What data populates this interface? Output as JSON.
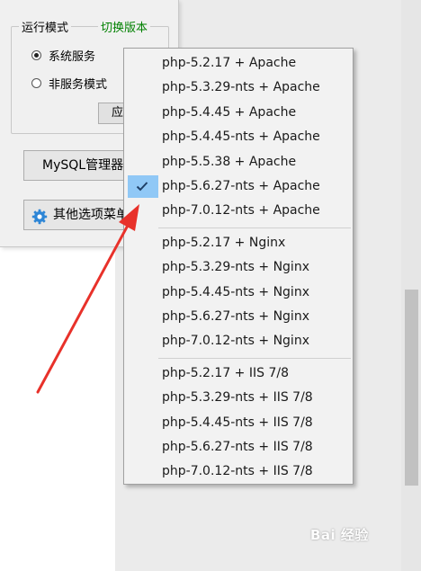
{
  "app": {
    "mode_group": {
      "legend": "运行模式",
      "switch_link": "切换版本",
      "options": [
        {
          "label": "系统服务",
          "checked": true
        },
        {
          "label": "非服务模式",
          "checked": false
        }
      ],
      "apply_label": "应"
    },
    "mysql_button_label": "MySQL管理器",
    "other_button_label": "其他选项菜单"
  },
  "menu": {
    "checked_index": 5,
    "groups": [
      {
        "items": [
          "php-5.2.17 + Apache",
          "php-5.3.29-nts + Apache",
          "php-5.4.45 + Apache",
          "php-5.4.45-nts + Apache",
          "php-5.5.38 + Apache",
          "php-5.6.27-nts + Apache",
          "php-7.0.12-nts + Apache"
        ]
      },
      {
        "items": [
          "php-5.2.17 + Nginx",
          "php-5.3.29-nts + Nginx",
          "php-5.4.45-nts + Nginx",
          "php-5.6.27-nts + Nginx",
          "php-7.0.12-nts + Nginx"
        ]
      },
      {
        "items": [
          "php-5.2.17 + IIS 7/8",
          "php-5.3.29-nts + IIS 7/8",
          "php-5.4.45-nts + IIS 7/8",
          "php-5.6.27-nts + IIS 7/8",
          "php-7.0.12-nts + IIS 7/8"
        ]
      }
    ]
  },
  "colors": {
    "checked_highlight": "#90c8f6",
    "switch_link": "#008000",
    "arrow": "#e8312a"
  },
  "watermark": "Bai 经验"
}
